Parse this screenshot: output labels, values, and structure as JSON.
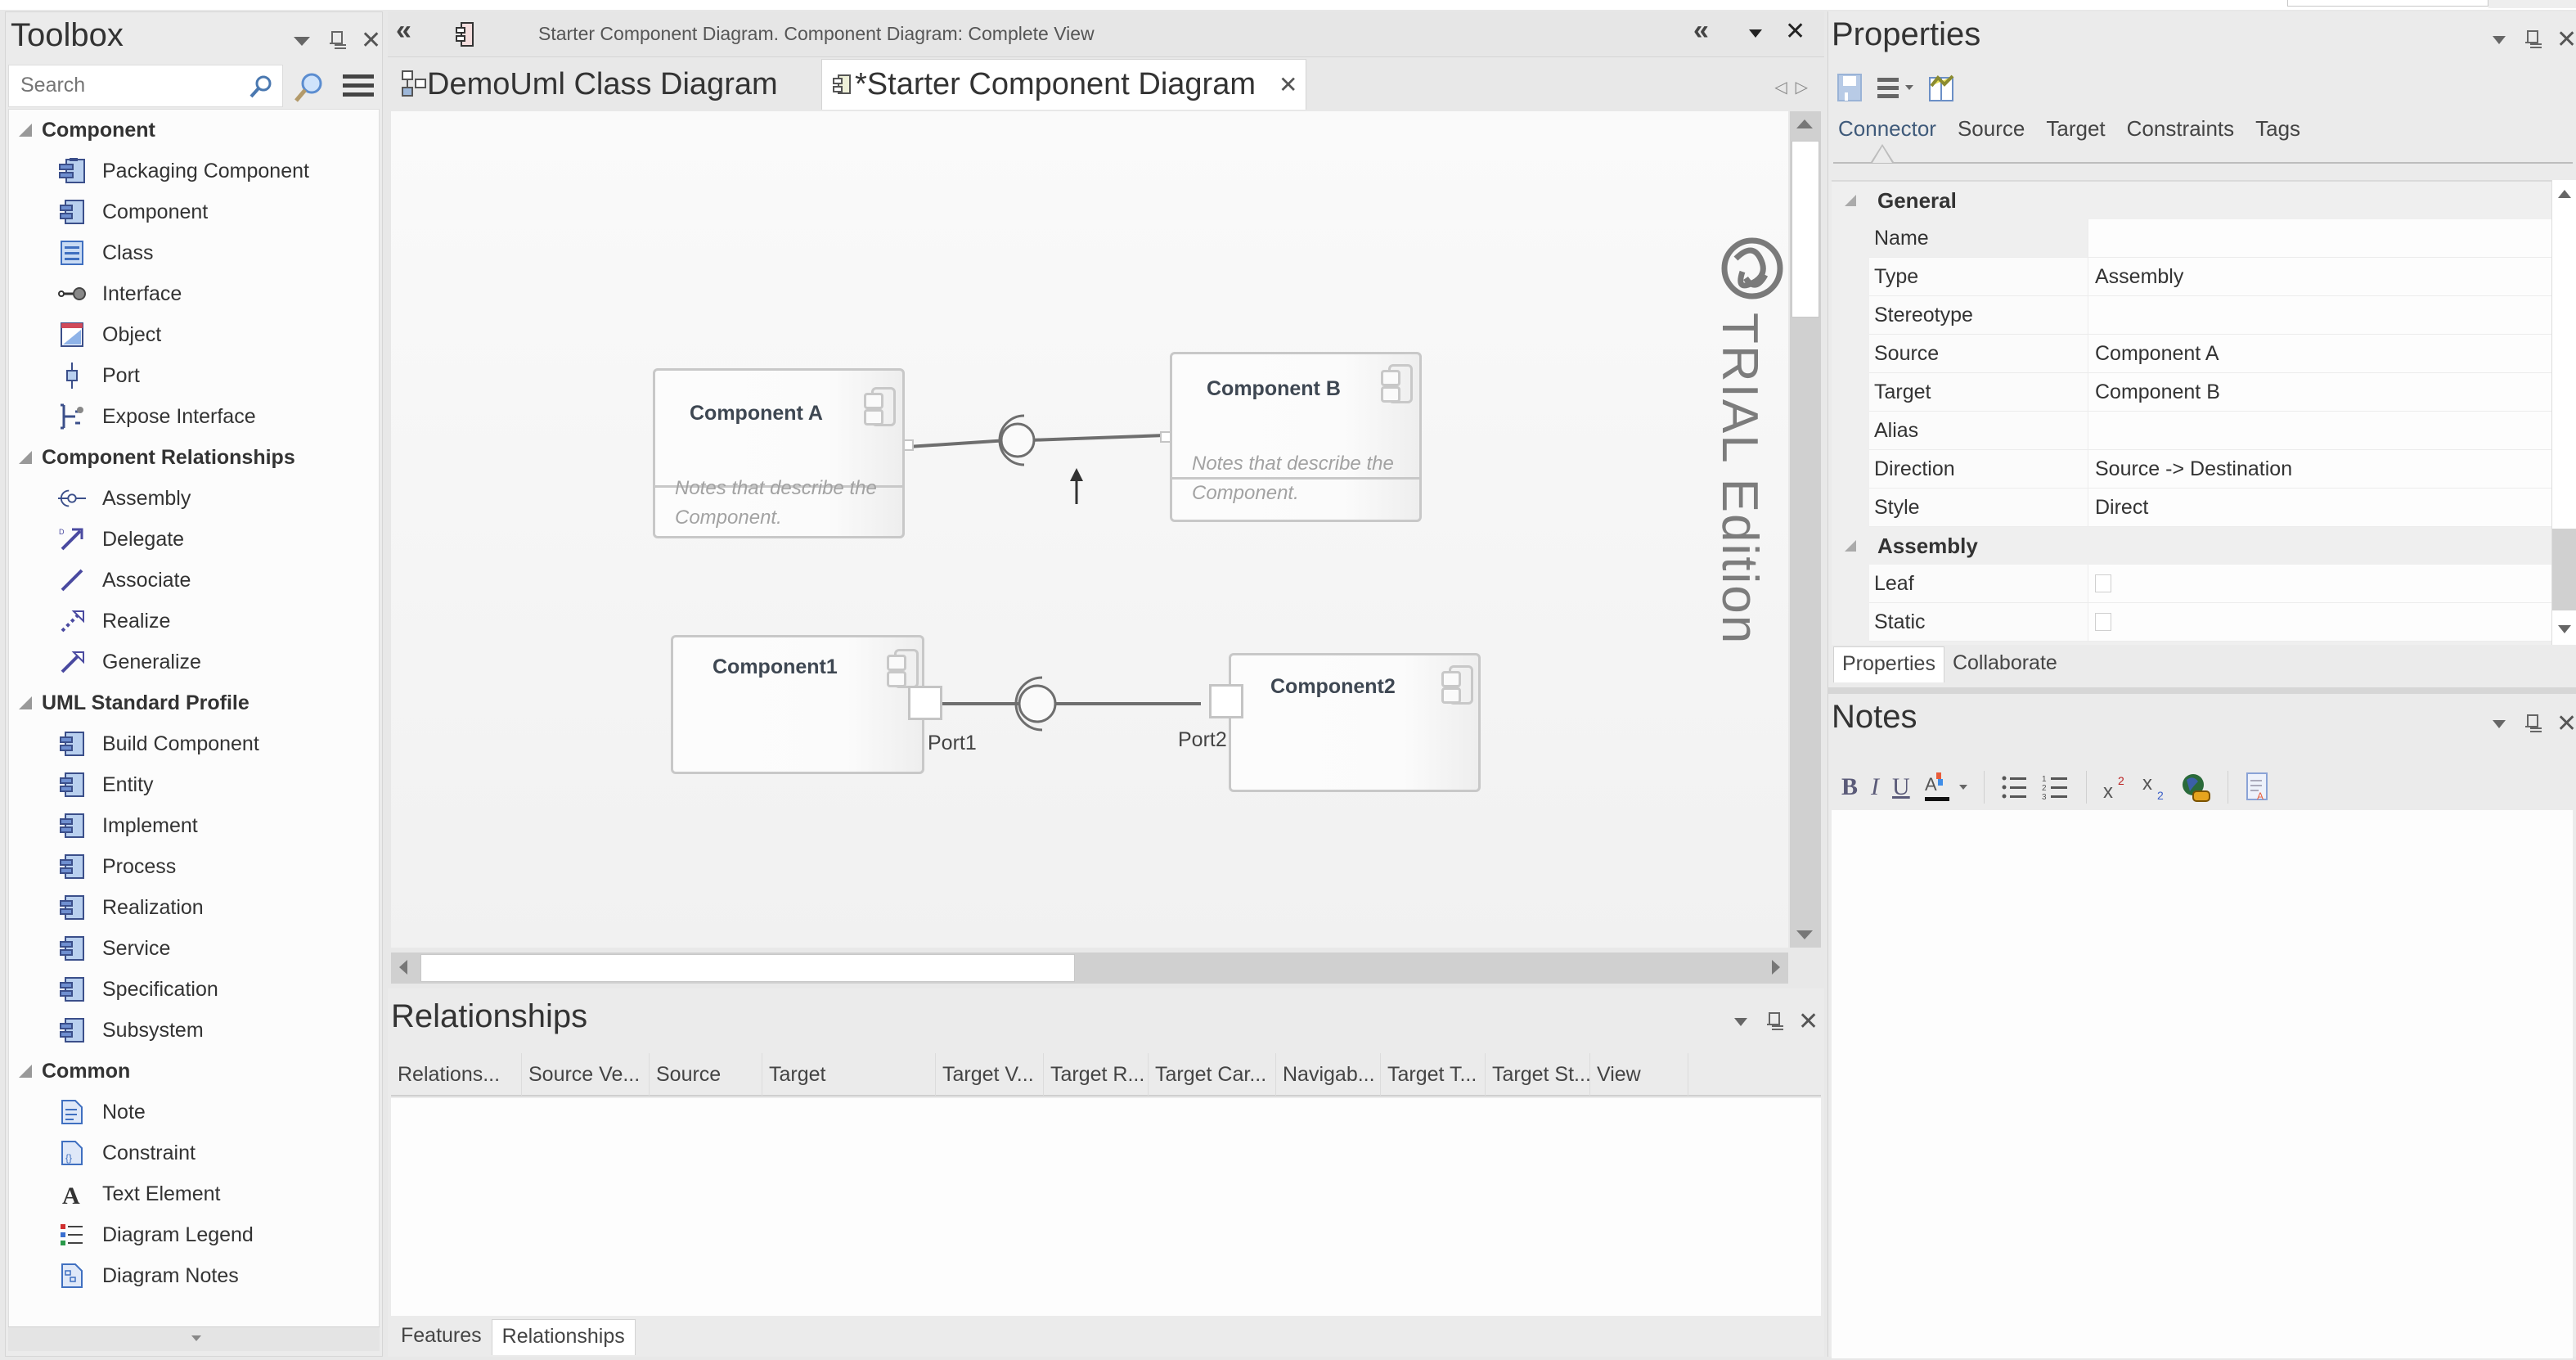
{
  "toolbox": {
    "title": "Toolbox",
    "search_placeholder": "Search",
    "groups": [
      {
        "label": "Component",
        "items": [
          {
            "label": "Packaging Component",
            "icon": "packaging-component-icon"
          },
          {
            "label": "Component",
            "icon": "component-icon"
          },
          {
            "label": "Class",
            "icon": "class-icon"
          },
          {
            "label": "Interface",
            "icon": "interface-icon"
          },
          {
            "label": "Object",
            "icon": "object-icon"
          },
          {
            "label": "Port",
            "icon": "port-icon"
          },
          {
            "label": "Expose Interface",
            "icon": "expose-interface-icon"
          }
        ]
      },
      {
        "label": "Component Relationships",
        "items": [
          {
            "label": "Assembly",
            "icon": "assembly-icon"
          },
          {
            "label": "Delegate",
            "icon": "delegate-icon"
          },
          {
            "label": "Associate",
            "icon": "associate-icon"
          },
          {
            "label": "Realize",
            "icon": "realize-icon"
          },
          {
            "label": "Generalize",
            "icon": "generalize-icon"
          }
        ]
      },
      {
        "label": "UML Standard Profile",
        "items": [
          {
            "label": "Build Component",
            "icon": "component-icon"
          },
          {
            "label": "Entity",
            "icon": "component-icon"
          },
          {
            "label": "Implement",
            "icon": "component-icon"
          },
          {
            "label": "Process",
            "icon": "component-icon"
          },
          {
            "label": "Realization",
            "icon": "component-icon"
          },
          {
            "label": "Service",
            "icon": "component-icon"
          },
          {
            "label": "Specification",
            "icon": "component-icon"
          },
          {
            "label": "Subsystem",
            "icon": "component-icon"
          }
        ]
      },
      {
        "label": "Common",
        "items": [
          {
            "label": "Note",
            "icon": "note-icon"
          },
          {
            "label": "Constraint",
            "icon": "constraint-icon"
          },
          {
            "label": "Text Element",
            "icon": "text-element-icon"
          },
          {
            "label": "Diagram Legend",
            "icon": "diagram-legend-icon"
          },
          {
            "label": "Diagram Notes",
            "icon": "diagram-notes-icon"
          }
        ]
      }
    ]
  },
  "diagram": {
    "breadcrumb": "Starter Component Diagram.  Component Diagram: Complete View",
    "tabs": [
      {
        "label": "DemoUml Class Diagram",
        "active": false
      },
      {
        "label": "*Starter Component Diagram",
        "active": true
      }
    ],
    "watermark": "TRIAL Edition",
    "components": [
      {
        "name": "Component A",
        "notes": "Notes that describe the Component."
      },
      {
        "name": "Component B",
        "notes": "Notes that describe the Component."
      },
      {
        "name": "Component1",
        "notes": ""
      },
      {
        "name": "Component2",
        "notes": ""
      }
    ],
    "ports": [
      "Port1",
      "Port2"
    ]
  },
  "relationships": {
    "title": "Relationships",
    "columns": [
      "Relations...",
      "Source Ve...",
      "Source",
      "Target",
      "Target V...",
      "Target R...",
      "Target Car...",
      "Navigab...",
      "Target T...",
      "Target St...",
      "View"
    ],
    "rows": [],
    "bottom_tabs": [
      {
        "label": "Features",
        "active": false
      },
      {
        "label": "Relationships",
        "active": true
      }
    ]
  },
  "properties": {
    "title": "Properties",
    "tabs": [
      {
        "label": "Connector",
        "active": true
      },
      {
        "label": "Source",
        "active": false
      },
      {
        "label": "Target",
        "active": false
      },
      {
        "label": "Constraints",
        "active": false
      },
      {
        "label": "Tags",
        "active": false
      }
    ],
    "general_label": "General",
    "general": [
      {
        "key": "Name",
        "value": ""
      },
      {
        "key": "Type",
        "value": "Assembly"
      },
      {
        "key": "Stereotype",
        "value": ""
      },
      {
        "key": "Source",
        "value": "Component A"
      },
      {
        "key": "Target",
        "value": "Component B"
      },
      {
        "key": "Alias",
        "value": ""
      },
      {
        "key": "Direction",
        "value": "Source -> Destination"
      },
      {
        "key": "Style",
        "value": "Direct"
      }
    ],
    "assembly_label": "Assembly",
    "assembly": [
      {
        "key": "Leaf",
        "checked": false
      },
      {
        "key": "Static",
        "checked": false
      }
    ],
    "bottom_tabs": [
      {
        "label": "Properties",
        "active": true
      },
      {
        "label": "Collaborate",
        "active": false
      }
    ]
  },
  "notes": {
    "title": "Notes",
    "toolbar": [
      "B",
      "I",
      "U"
    ],
    "content": ""
  }
}
